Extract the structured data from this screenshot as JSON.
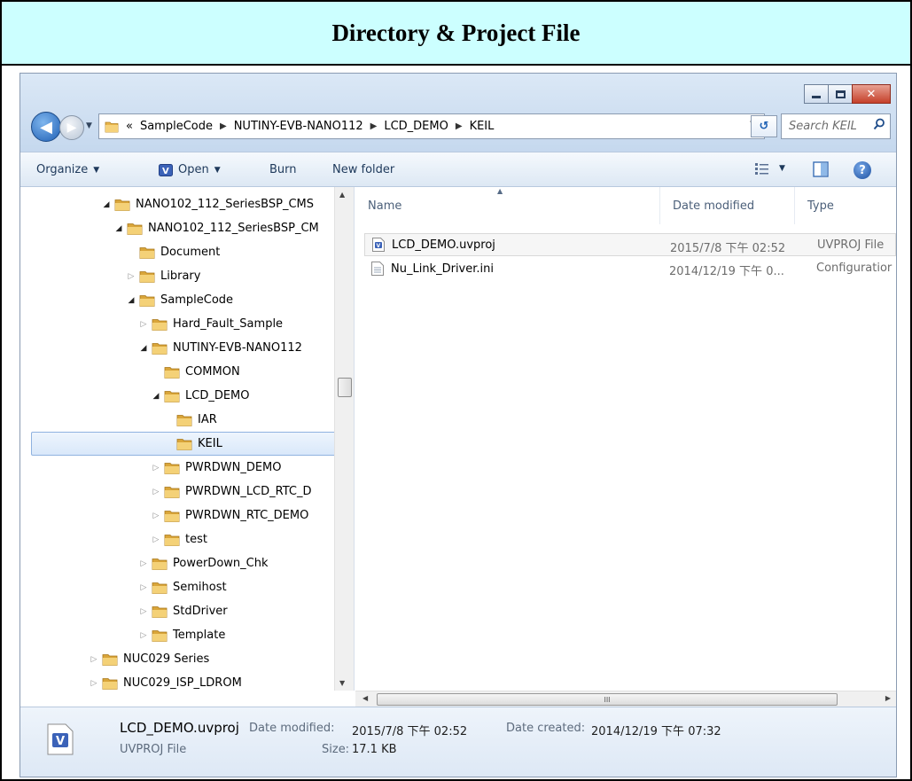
{
  "caption": "Directory & Project File",
  "window": {
    "breadcrumb_prefix": "«",
    "breadcrumb": [
      "SampleCode",
      "NUTINY-EVB-NANO112",
      "LCD_DEMO",
      "KEIL"
    ],
    "search_placeholder": "Search KEIL"
  },
  "toolbar": {
    "organize": "Organize",
    "open": "Open",
    "burn": "Burn",
    "new_folder": "New folder"
  },
  "tree": [
    {
      "label": "NANO102_112_SeriesBSP_CMS",
      "indent": 6,
      "expander": "open",
      "selected": false
    },
    {
      "label": "NANO102_112_SeriesBSP_CM",
      "indent": 7,
      "expander": "open",
      "selected": false
    },
    {
      "label": "Document",
      "indent": 8,
      "expander": "none",
      "selected": false
    },
    {
      "label": "Library",
      "indent": 8,
      "expander": "closed",
      "selected": false
    },
    {
      "label": "SampleCode",
      "indent": 8,
      "expander": "open",
      "selected": false
    },
    {
      "label": "Hard_Fault_Sample",
      "indent": 9,
      "expander": "closed",
      "selected": false
    },
    {
      "label": "NUTINY-EVB-NANO112",
      "indent": 9,
      "expander": "open",
      "selected": false
    },
    {
      "label": "COMMON",
      "indent": 10,
      "expander": "none",
      "selected": false
    },
    {
      "label": "LCD_DEMO",
      "indent": 10,
      "expander": "open",
      "selected": false
    },
    {
      "label": "IAR",
      "indent": 11,
      "expander": "none",
      "selected": false
    },
    {
      "label": "KEIL",
      "indent": 11,
      "expander": "none",
      "selected": true
    },
    {
      "label": "PWRDWN_DEMO",
      "indent": 10,
      "expander": "closed",
      "selected": false
    },
    {
      "label": "PWRDWN_LCD_RTC_D",
      "indent": 10,
      "expander": "closed",
      "selected": false
    },
    {
      "label": "PWRDWN_RTC_DEMO",
      "indent": 10,
      "expander": "closed",
      "selected": false
    },
    {
      "label": "test",
      "indent": 10,
      "expander": "closed",
      "selected": false
    },
    {
      "label": "PowerDown_Chk",
      "indent": 9,
      "expander": "closed",
      "selected": false
    },
    {
      "label": "Semihost",
      "indent": 9,
      "expander": "closed",
      "selected": false
    },
    {
      "label": "StdDriver",
      "indent": 9,
      "expander": "closed",
      "selected": false
    },
    {
      "label": "Template",
      "indent": 9,
      "expander": "closed",
      "selected": false
    },
    {
      "label": "NUC029 Series",
      "indent": 5,
      "expander": "closed",
      "selected": false
    },
    {
      "label": "NUC029_ISP_LDROM",
      "indent": 5,
      "expander": "closed",
      "selected": false
    }
  ],
  "columns": {
    "name": "Name",
    "date": "Date modified",
    "type": "Type"
  },
  "files": [
    {
      "name": "LCD_DEMO.uvproj",
      "date": "2015/7/8 下午 02:52",
      "type": "UVPROJ File",
      "icon": "uvproj-file-icon"
    },
    {
      "name": "Nu_Link_Driver.ini",
      "date": "2014/12/19 下午 0...",
      "type": "Configuratior",
      "icon": "ini-file-icon"
    }
  ],
  "details": {
    "name": "LCD_DEMO.uvproj",
    "type": "UVPROJ File",
    "modified_label": "Date modified:",
    "modified_value": "2015/7/8 下午 02:52",
    "created_label": "Date created:",
    "created_value": "2014/12/19 下午 07:32",
    "size_label": "Size:",
    "size_value": "17.1 KB"
  },
  "colors": {
    "caption_bg": "#ccffff",
    "selection_border": "#8fb2e0",
    "folder": "#e8b54a"
  }
}
